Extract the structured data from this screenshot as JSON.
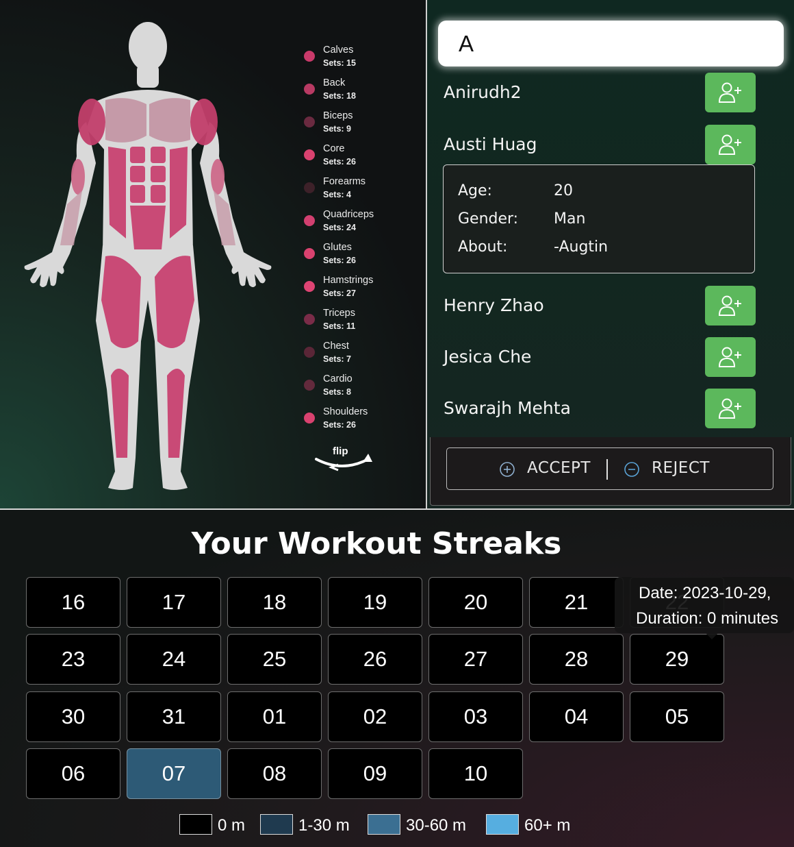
{
  "muscle_legend": [
    {
      "name": "Calves",
      "sets": "Sets: 15",
      "color": "#c93a6a"
    },
    {
      "name": "Back",
      "sets": "Sets: 18",
      "color": "#b83a63"
    },
    {
      "name": "Biceps",
      "sets": "Sets: 9",
      "color": "#6a2a40"
    },
    {
      "name": "Core",
      "sets": "Sets: 26",
      "color": "#d9426f"
    },
    {
      "name": "Forearms",
      "sets": "Sets: 4",
      "color": "#3d2129"
    },
    {
      "name": "Quadriceps",
      "sets": "Sets: 24",
      "color": "#d24070"
    },
    {
      "name": "Glutes",
      "sets": "Sets: 26",
      "color": "#d9426f"
    },
    {
      "name": "Hamstrings",
      "sets": "Sets: 27",
      "color": "#de4473"
    },
    {
      "name": "Triceps",
      "sets": "Sets: 11",
      "color": "#7a2c48"
    },
    {
      "name": "Chest",
      "sets": "Sets: 7",
      "color": "#5a2637"
    },
    {
      "name": "Cardio",
      "sets": "Sets: 8",
      "color": "#632a3c"
    },
    {
      "name": "Shoulders",
      "sets": "Sets: 26",
      "color": "#d9426f"
    }
  ],
  "flip_label": "flip",
  "search": {
    "value": "A",
    "placeholder": ""
  },
  "users": [
    {
      "name": "Anirudh2"
    },
    {
      "name": "Austi Huag"
    },
    {
      "name": "Henry Zhao"
    },
    {
      "name": "Jesica Che"
    },
    {
      "name": "Swarajh Mehta"
    }
  ],
  "user_detail": {
    "age_label": "Age:",
    "age": "20",
    "gender_label": "Gender:",
    "gender": "Man",
    "about_label": "About:",
    "about": "-Augtin"
  },
  "actions": {
    "accept": "ACCEPT",
    "reject": "REJECT"
  },
  "streaks": {
    "title": "Your Workout Streaks",
    "days": [
      {
        "label": "16",
        "level": "0 m"
      },
      {
        "label": "17",
        "level": "0 m"
      },
      {
        "label": "18",
        "level": "0 m"
      },
      {
        "label": "19",
        "level": "0 m"
      },
      {
        "label": "20",
        "level": "0 m"
      },
      {
        "label": "21",
        "level": "0 m"
      },
      {
        "label": "22",
        "level": "0 m"
      },
      {
        "label": "23",
        "level": "0 m"
      },
      {
        "label": "24",
        "level": "0 m"
      },
      {
        "label": "25",
        "level": "0 m"
      },
      {
        "label": "26",
        "level": "0 m"
      },
      {
        "label": "27",
        "level": "0 m"
      },
      {
        "label": "28",
        "level": "0 m"
      },
      {
        "label": "29",
        "level": "0 m"
      },
      {
        "label": "30",
        "level": "0 m"
      },
      {
        "label": "31",
        "level": "0 m"
      },
      {
        "label": "01",
        "level": "0 m"
      },
      {
        "label": "02",
        "level": "0 m"
      },
      {
        "label": "03",
        "level": "0 m"
      },
      {
        "label": "04",
        "level": "0 m"
      },
      {
        "label": "05",
        "level": "0 m"
      },
      {
        "label": "06",
        "level": "0 m"
      },
      {
        "label": "07",
        "level": "1-30 m"
      },
      {
        "label": "08",
        "level": "0 m"
      },
      {
        "label": "09",
        "level": "0 m"
      },
      {
        "label": "10",
        "level": "0 m"
      }
    ],
    "tooltip": {
      "line1": "Date: 2023-10-29,",
      "line2": "Duration: 0 minutes"
    },
    "key": [
      {
        "label": "0 m",
        "color": "#000000"
      },
      {
        "label": "1-30 m",
        "color": "#1f3a4f"
      },
      {
        "label": "30-60 m",
        "color": "#3b6f92"
      },
      {
        "label": "60+ m",
        "color": "#56aee0"
      }
    ]
  }
}
